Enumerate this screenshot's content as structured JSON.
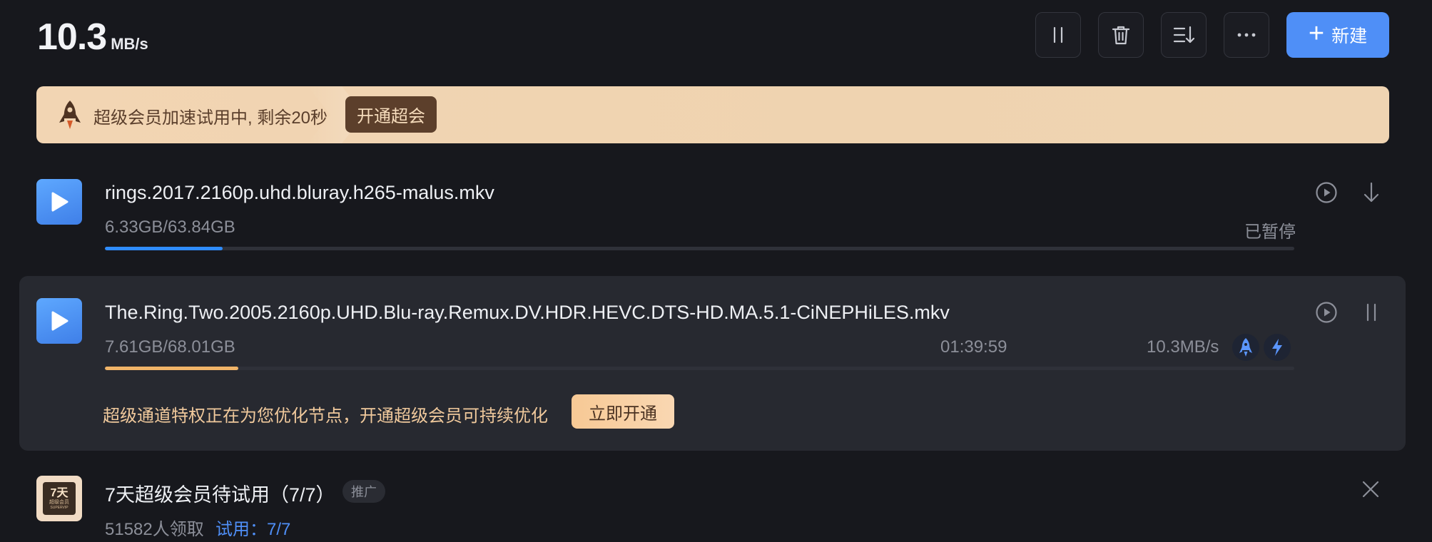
{
  "header": {
    "speed_value": "10.3",
    "speed_unit": "MB/s",
    "toolbar": {
      "pause_all_icon": "pause-icon",
      "delete_icon": "trash-icon",
      "sort_icon": "sort-icon",
      "more_icon": "more-icon",
      "new_label": "新建"
    }
  },
  "banner": {
    "text": "超级会员加速试用中, 剩余20秒",
    "button_label": "开通超会"
  },
  "tasks": [
    {
      "filename": "rings.2017.2160p.uhd.bluray.h265-malus.mkv",
      "size": "6.33GB/63.84GB",
      "status": "已暂停",
      "progress": 0.099,
      "progress_color": "#2f8cff"
    },
    {
      "filename": "The.Ring.Two.2005.2160p.UHD.Blu-ray.Remux.DV.HDR.HEVC.DTS-HD.MA.5.1-CiNEPHiLES.mkv",
      "size": "7.61GB/68.01GB",
      "time_left": "01:39:59",
      "speed": "10.3MB/s",
      "progress": 0.112,
      "progress_color": "#f0b468",
      "promo_text": "超级通道特权正在为您优化节点，开通超级会员可持续优化",
      "promo_button": "立即开通"
    }
  ],
  "trial": {
    "icon_big": "7天",
    "icon_small": "超级会员",
    "icon_tiny": "SUPERVIP",
    "title": "7天超级会员待试用（7/7）",
    "tag": "推广",
    "claimed": "51582人领取",
    "trial_link": "试用：7/7"
  },
  "colors": {
    "accent": "#4f8ff7",
    "background": "#17181d",
    "banner": "#efd3b0",
    "promo_text": "#f0c99c"
  }
}
